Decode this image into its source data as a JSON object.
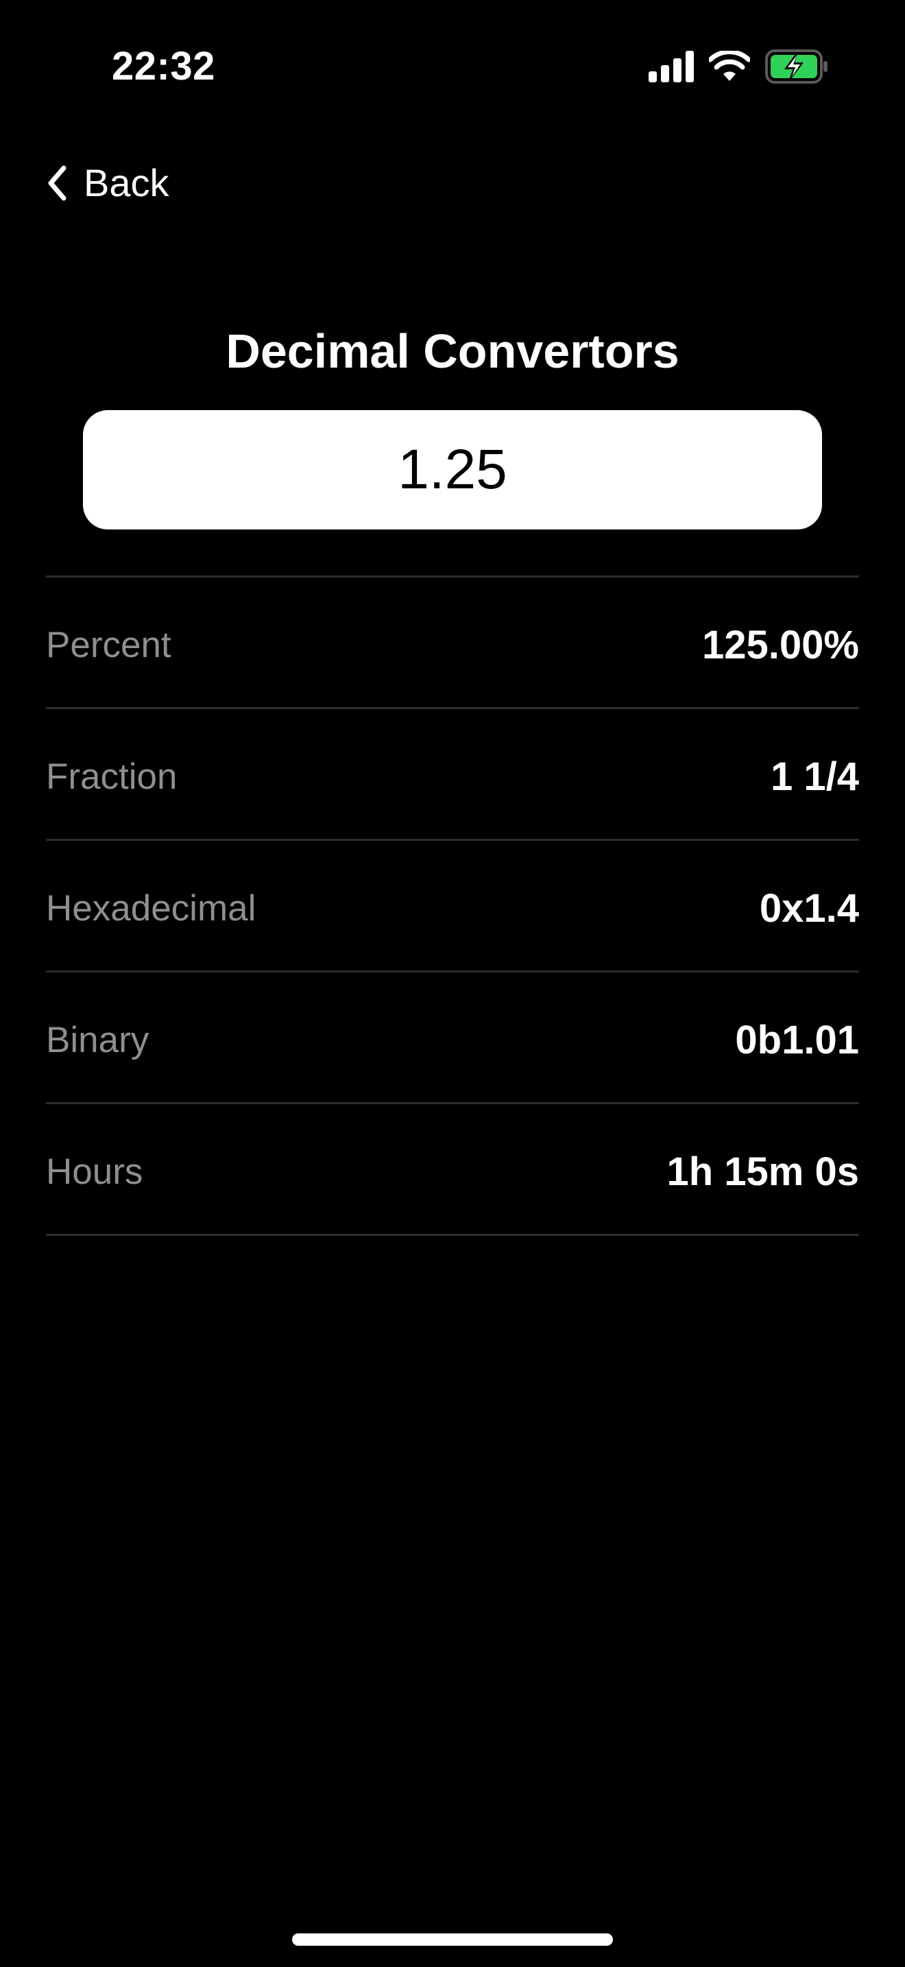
{
  "status_bar": {
    "time": "22:32",
    "icons": [
      "signal-icon",
      "wifi-icon",
      "battery-charging-icon"
    ],
    "battery_color": "#30d158"
  },
  "nav": {
    "back_label": "Back",
    "back_icon": "chevron-left-icon"
  },
  "page": {
    "title": "Decimal Convertors"
  },
  "input": {
    "value": "1.25"
  },
  "conversions": [
    {
      "label": "Percent",
      "value": "125.00%"
    },
    {
      "label": "Fraction",
      "value": "1 1/4"
    },
    {
      "label": "Hexadecimal",
      "value": "0x1.4"
    },
    {
      "label": "Binary",
      "value": "0b1.01"
    },
    {
      "label": "Hours",
      "value": "1h 15m 0s"
    }
  ],
  "colors": {
    "background": "#000000",
    "label_gray": "#8e8e93",
    "divider": "#2c2c2e"
  }
}
